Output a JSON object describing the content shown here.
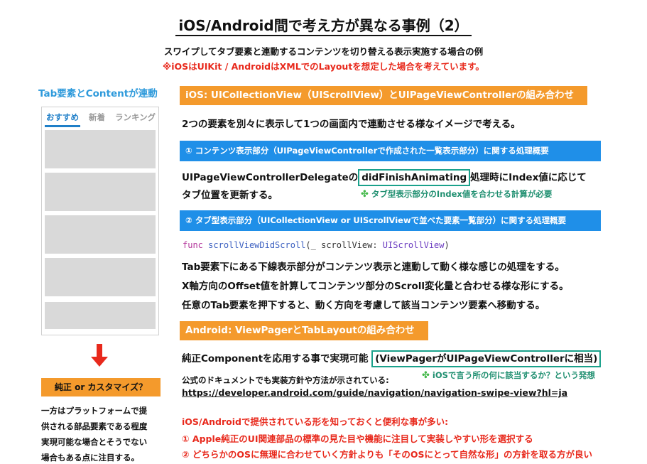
{
  "title": "iOS/Android間で考え方が異なる事例（2）",
  "subtitle": "スワイプしてタブ要素と連動するコンテンツを切り替える表示実施する場合の例",
  "note": "※iOSはUIKit / AndroidはXMLでのLayoutを想定した場合を考えています。",
  "left": {
    "heading": "Tab要素とContentが連動",
    "tabs": [
      "おすすめ",
      "新着",
      "ランキング"
    ],
    "decision_label": "純正 or カスタマイズ？",
    "paragraph_lines": [
      "一方はプラットフォームで提",
      "供される部品要素である程度",
      "実現可能な場合とそうでない",
      "場合もある点に注目する。"
    ]
  },
  "ios": {
    "header": "iOS: UICollectionView（UIScrollView）とUIPageViewControllerの組み合わせ",
    "intro": "2つの要素を別々に表示して1つの画面内で連動させる様なイメージで考える。",
    "section1_header": "① コンテンツ表示部分（UIPageViewControllerで作成された一覧表示部分）に関する処理概要",
    "section1_line1_before": "UIPageViewControllerDelegateの",
    "section1_highlight": "didFinishAnimating",
    "section1_line1_after": "処理時にIndex値に応じて",
    "section1_line2": "タブ位置を更新する。",
    "section1_note": "タブ型表示部分のIndex値を合わせる計算が必要",
    "section2_header": "② タブ型表示部分（UICollectionView or UIScrollViewで並べた要素一覧部分）に関する処理概要",
    "code": {
      "keyword": "func",
      "name": "scrollViewDidScroll",
      "params": "(_ scrollView: ",
      "type": "UIScrollView",
      "close": ")"
    },
    "section2_lines": [
      "Tab要素下にある下線表示部分がコンテンツ表示と連動して動く様な感じの処理をする。",
      "X軸方向のOffset値を計算してコンテンツ部分のScroll変化量と合わせる様な形にする。",
      "任意のTab要素を押下すると、動く方向を考慮して該当コンテンツ要素へ移動する。"
    ]
  },
  "android": {
    "header": "Android: ViewPagerとTabLayoutの組み合わせ",
    "line1": "純正Componentを応用する事で実現可能",
    "highlight": "(ViewPagerがUIPageViewControllerに相当)",
    "docs_text": "公式のドキュメントでも実装方針や方法が示されている:",
    "docs_note": "iOSで言う所の何に該当するか？という発想",
    "link": "https://developer.android.com/guide/navigation/navigation-swipe-view?hl=ja",
    "tips_heading": "iOS/Androidで提供されている形を知っておくと便利な事が多い:",
    "tips": [
      "① Apple純正のUI関連部品の標準の見た目や機能に注目して実装しやすい形を選択する",
      "② どちらかのOSに無理に合わせていく方針よりも「そのOSにとって自然な形」の方針を取る方が良い"
    ]
  },
  "colors": {
    "orange": "#f49a2c",
    "blue": "#1f8fe8",
    "red": "#e8291c",
    "teal": "#1aa18b",
    "heading_blue": "#2e9adb"
  }
}
